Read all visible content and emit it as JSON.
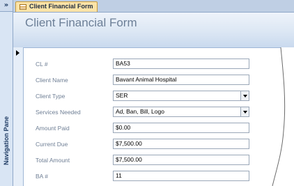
{
  "nav": {
    "toggle": "»",
    "label": "Navigation Pane"
  },
  "tab": {
    "label": "Client Financial Form",
    "icon": "form-icon"
  },
  "header": {
    "title": "Client Financial Form"
  },
  "fields": [
    {
      "label": "CL #",
      "value": "BA53"
    },
    {
      "label": "Client Name",
      "value": "Bavant Animal Hospital"
    },
    {
      "label": "Client Type",
      "value": "SER"
    },
    {
      "label": "Services Needed",
      "value": "Ad, Ban, Bill, Logo"
    },
    {
      "label": "Amount Paid",
      "value": "$0.00"
    },
    {
      "label": "Current Due",
      "value": "$7,500.00"
    },
    {
      "label": "Total Amount",
      "value": "$7,500.00"
    },
    {
      "label": "BA #",
      "value": "11"
    }
  ],
  "colors": {
    "tab_active": "#fbe3a7",
    "header_gradient_bottom": "#c9d9ee",
    "nav_bg": "#d9e5f4"
  }
}
